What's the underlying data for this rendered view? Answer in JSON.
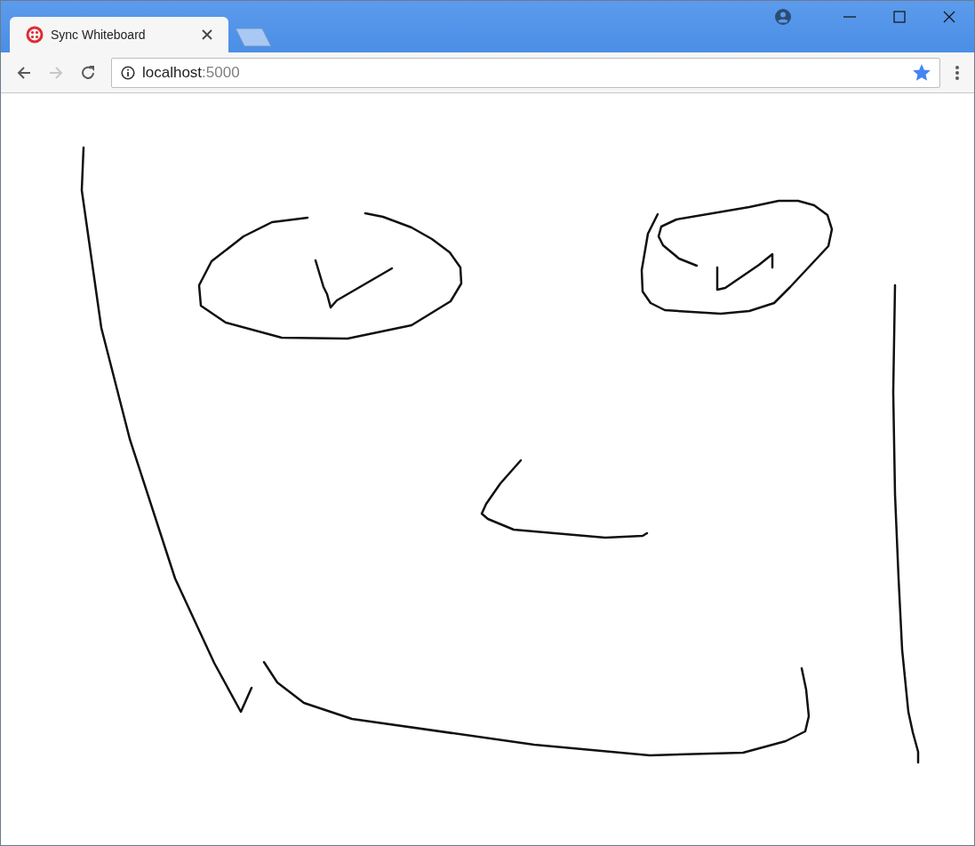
{
  "tabs": [
    {
      "title": "Sync Whiteboard",
      "selected": true
    }
  ],
  "toolbar": {
    "back_disabled": false,
    "forward_disabled": true
  },
  "address": {
    "host": "localhost",
    "port": ":5000",
    "bookmarked": true
  }
}
